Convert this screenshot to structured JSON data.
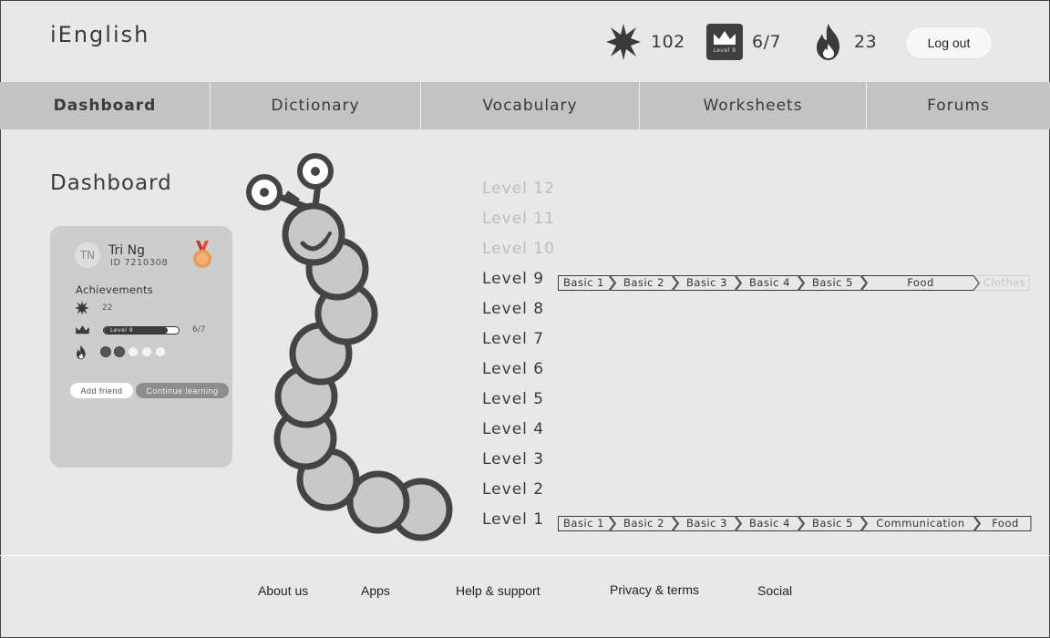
{
  "app": {
    "logo": "iEnglish"
  },
  "header": {
    "points": {
      "icon": "star-splat-icon",
      "value": "102"
    },
    "level": {
      "icon": "crown-badge-icon",
      "badge_text": "Level 9",
      "value": "6/7"
    },
    "streak": {
      "icon": "flame-icon",
      "value": "23"
    },
    "logout_label": "Log out"
  },
  "nav": {
    "tabs": [
      {
        "label": "Dashboard",
        "active": true
      },
      {
        "label": "Dictionary",
        "active": false
      },
      {
        "label": "Vocabulary",
        "active": false
      },
      {
        "label": "Worksheets",
        "active": false
      },
      {
        "label": "Forums",
        "active": false
      }
    ]
  },
  "dashboard": {
    "title": "Dashboard",
    "profile": {
      "initials": "TN",
      "name": "Tri Ng",
      "id": "ID 7210308",
      "medal_icon": "bronze-medal-icon"
    },
    "achievements": {
      "title": "Achievements",
      "points": "22",
      "level_badge": "Level 9",
      "level_progress": "6/7",
      "level_fraction": 0.857,
      "streak_days": [
        "done",
        "done",
        "todo",
        "todo",
        "todo"
      ]
    },
    "buttons": {
      "add_friend": "Add friend",
      "continue": "Continue learning"
    }
  },
  "levels": [
    {
      "label": "Level 12",
      "unlocked": false
    },
    {
      "label": "Level 11",
      "unlocked": false
    },
    {
      "label": "Level 10",
      "unlocked": false
    },
    {
      "label": "Level 9",
      "unlocked": true,
      "courses": [
        {
          "name": "Basic 1",
          "status": "done"
        },
        {
          "name": "Basic 2",
          "status": "done"
        },
        {
          "name": "Basic 3",
          "status": "done"
        },
        {
          "name": "Basic 4",
          "status": "done"
        },
        {
          "name": "Basic 5",
          "status": "done"
        },
        {
          "name": "Food",
          "status": "done"
        },
        {
          "name": "Clothes",
          "status": "locked"
        }
      ]
    },
    {
      "label": "Level 8",
      "unlocked": true
    },
    {
      "label": "Level 7",
      "unlocked": true
    },
    {
      "label": "Level 6",
      "unlocked": true
    },
    {
      "label": "Level 5",
      "unlocked": true
    },
    {
      "label": "Level 4",
      "unlocked": true
    },
    {
      "label": "Level 3",
      "unlocked": true
    },
    {
      "label": "Level 2",
      "unlocked": true
    },
    {
      "label": "Level 1",
      "unlocked": true,
      "courses": [
        {
          "name": "Basic 1",
          "status": "done"
        },
        {
          "name": "Basic 2",
          "status": "done"
        },
        {
          "name": "Basic 3",
          "status": "done"
        },
        {
          "name": "Basic 4",
          "status": "done"
        },
        {
          "name": "Basic 5",
          "status": "done"
        },
        {
          "name": "Communication",
          "status": "done"
        },
        {
          "name": "Food",
          "status": "done"
        }
      ]
    }
  ],
  "footer": {
    "links": [
      "About us",
      "Apps",
      "Help & support",
      "Privacy & terms",
      "Social"
    ]
  },
  "colors": {
    "background": "#e8e8e8",
    "nav": "#c3c3c3",
    "card": "#cdcdcd",
    "ink": "#3a3a3a",
    "locked": "#bdbdbd",
    "medal": "#e08a4a"
  }
}
